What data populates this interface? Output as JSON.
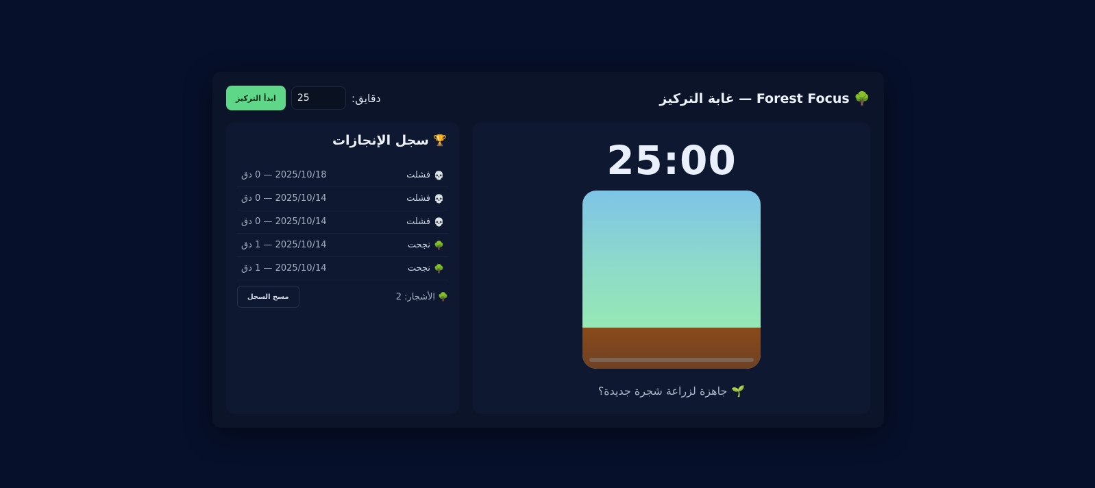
{
  "header": {
    "title": "🌳 Forest Focus — غابة التركيز",
    "minutes_label": "دقايق:",
    "minutes_value": "25",
    "start_label": "ابدأ التركيز"
  },
  "timer": {
    "display": "25:00",
    "progress_percent": 0,
    "status_icon": "🌱",
    "status_text": "جاهزة لزراعة شجرة جديدة؟"
  },
  "log": {
    "title_icon": "🏆",
    "title": "سجل الإنجازات",
    "entries": [
      {
        "icon": "💀",
        "result": "فشلت",
        "date": "2025/10/18 — 0 دق"
      },
      {
        "icon": "💀",
        "result": "فشلت",
        "date": "2025/10/14 — 0 دق"
      },
      {
        "icon": "💀",
        "result": "فشلت",
        "date": "2025/10/14 — 0 دق"
      },
      {
        "icon": "🌳",
        "result": "نجحت",
        "date": "2025/10/14 — 1 دق"
      },
      {
        "icon": "🌳",
        "result": "نجحت",
        "date": "2025/10/14 — 1 دق"
      }
    ],
    "trees_icon": "🌳",
    "trees_label": "الأشجار: 2",
    "clear_label": "مسح السجل"
  },
  "colors": {
    "accent": "#5fd789",
    "background": "#07102a",
    "panel": "#0e1830",
    "sky_top": "#7ec4e6",
    "sky_bottom": "#9bf0a6",
    "ground": "#8a4a1a"
  }
}
